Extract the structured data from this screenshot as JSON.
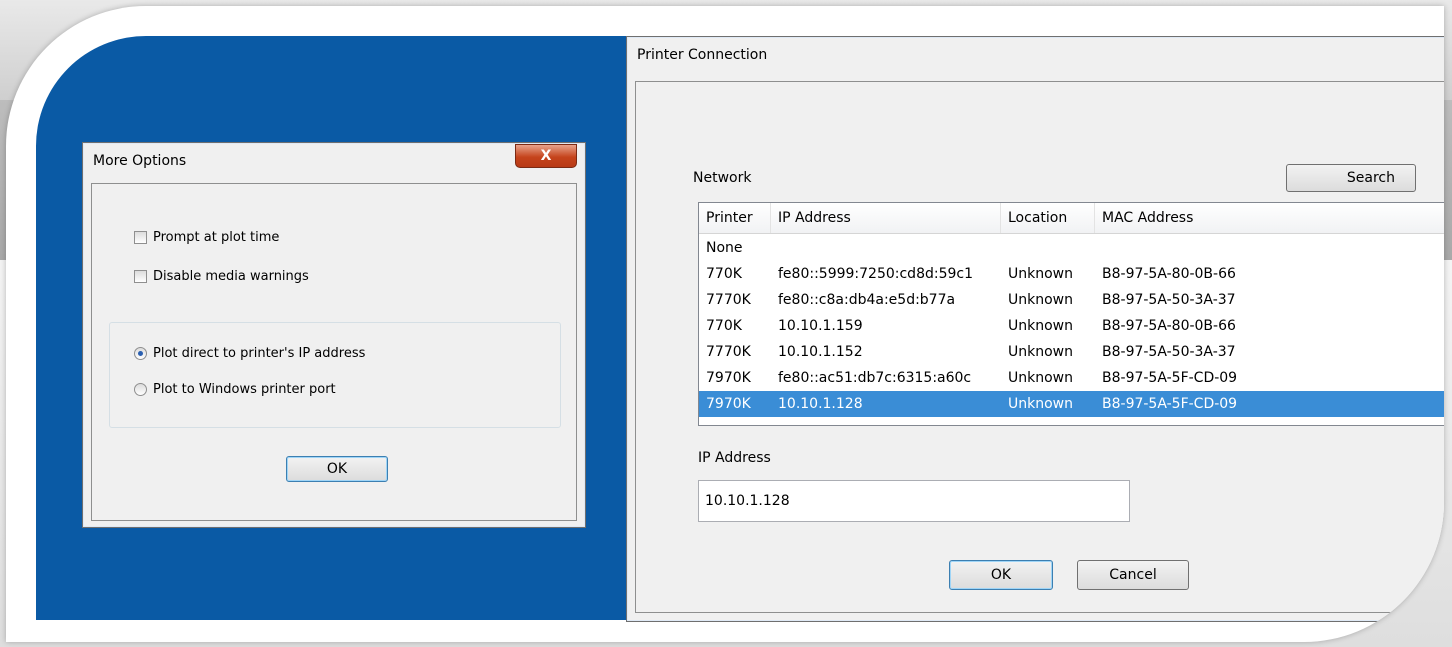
{
  "more_options": {
    "title": "More Options",
    "close_glyph": "X",
    "prompt_label": "Prompt at plot time",
    "disable_media_label": "Disable media warnings",
    "radio_ip_label": "Plot direct to printer's IP address",
    "radio_port_label": "Plot to Windows printer port",
    "ok_label": "OK"
  },
  "printer_connection": {
    "title": "Printer Connection",
    "network_label": "Network",
    "search_label": "Search",
    "columns": {
      "printer": "Printer",
      "ip": "IP Address",
      "location": "Location",
      "mac": "MAC Address"
    },
    "rows": [
      {
        "printer": "None",
        "ip": "",
        "location": "",
        "mac": "",
        "selected": false
      },
      {
        "printer": "770K",
        "ip": "fe80::5999:7250:cd8d:59c1",
        "location": "Unknown",
        "mac": "B8-97-5A-80-0B-66",
        "selected": false
      },
      {
        "printer": "7770K",
        "ip": "fe80::c8a:db4a:e5d:b77a",
        "location": "Unknown",
        "mac": "B8-97-5A-50-3A-37",
        "selected": false
      },
      {
        "printer": "770K",
        "ip": "10.10.1.159",
        "location": "Unknown",
        "mac": "B8-97-5A-80-0B-66",
        "selected": false
      },
      {
        "printer": "7770K",
        "ip": "10.10.1.152",
        "location": "Unknown",
        "mac": "B8-97-5A-50-3A-37",
        "selected": false
      },
      {
        "printer": "7970K",
        "ip": "fe80::ac51:db7c:6315:a60c",
        "location": "Unknown",
        "mac": "B8-97-5A-5F-CD-09",
        "selected": false
      },
      {
        "printer": "7970K",
        "ip": "10.10.1.128",
        "location": "Unknown",
        "mac": "B8-97-5A-5F-CD-09",
        "selected": true
      }
    ],
    "ip_address_label": "IP Address",
    "ip_address_value": "10.10.1.128",
    "ok_label": "OK",
    "cancel_label": "Cancel"
  },
  "colors": {
    "background_blue": "#0a5aa5",
    "selection": "#3a8dd6"
  }
}
